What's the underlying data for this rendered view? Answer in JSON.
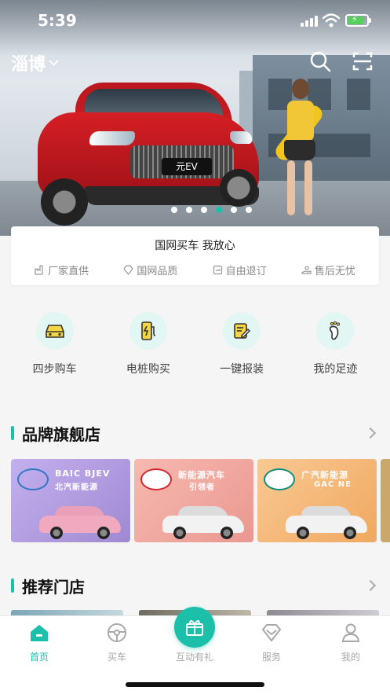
{
  "status_bar": {
    "time": "5:39"
  },
  "location": {
    "city": "淄博"
  },
  "hero": {
    "plate_text": "元EV",
    "dots_total": 6,
    "active_dot": 4
  },
  "promise": {
    "title": "国网买车  我放心",
    "items": [
      {
        "icon": "factory-icon",
        "label": "厂家直供"
      },
      {
        "icon": "diamond-icon",
        "label": "国网品质"
      },
      {
        "icon": "return-icon",
        "label": "自由退订"
      },
      {
        "icon": "service-hand-icon",
        "label": "售后无忧"
      }
    ]
  },
  "quick_actions": [
    {
      "icon": "car-front-icon",
      "label": "四步购车"
    },
    {
      "icon": "charging-pile-icon",
      "label": "电桩购买"
    },
    {
      "icon": "report-edit-icon",
      "label": "一键报装"
    },
    {
      "icon": "footprint-icon",
      "label": "我的足迹"
    }
  ],
  "sections": {
    "brands": {
      "title": "品牌旗舰店"
    },
    "stores": {
      "title": "推荐门店"
    }
  },
  "brands": [
    {
      "logo_color": "#2f76c5",
      "name_en": "BAIC BJEV",
      "name_cn": "北汽新能源",
      "bg": "#b59ee0",
      "car": "#f0a9bf"
    },
    {
      "logo_color": "#d4262f",
      "name_en": "新能源汽车",
      "name_cn": "引领者",
      "bg": "#f1a5a0",
      "car": "#f2f2f2"
    },
    {
      "logo_color": "#0b8f7a",
      "name_en": "广汽新能源",
      "name_cn": "GAC NE",
      "bg": "#f6bb7a",
      "car": "#f2f2f2"
    }
  ],
  "tabbar": {
    "items": [
      {
        "icon": "home-icon",
        "label": "首页",
        "active": true
      },
      {
        "icon": "steering-wheel-icon",
        "label": "买车",
        "active": false
      },
      {
        "icon": "gift-icon",
        "label": "互动有礼",
        "active": false
      },
      {
        "icon": "service-diamond-icon",
        "label": "服务",
        "active": false
      },
      {
        "icon": "person-icon",
        "label": "我的",
        "active": false
      }
    ]
  },
  "colors": {
    "accent": "#1bbfaa",
    "inactive": "#a8a8a8"
  }
}
